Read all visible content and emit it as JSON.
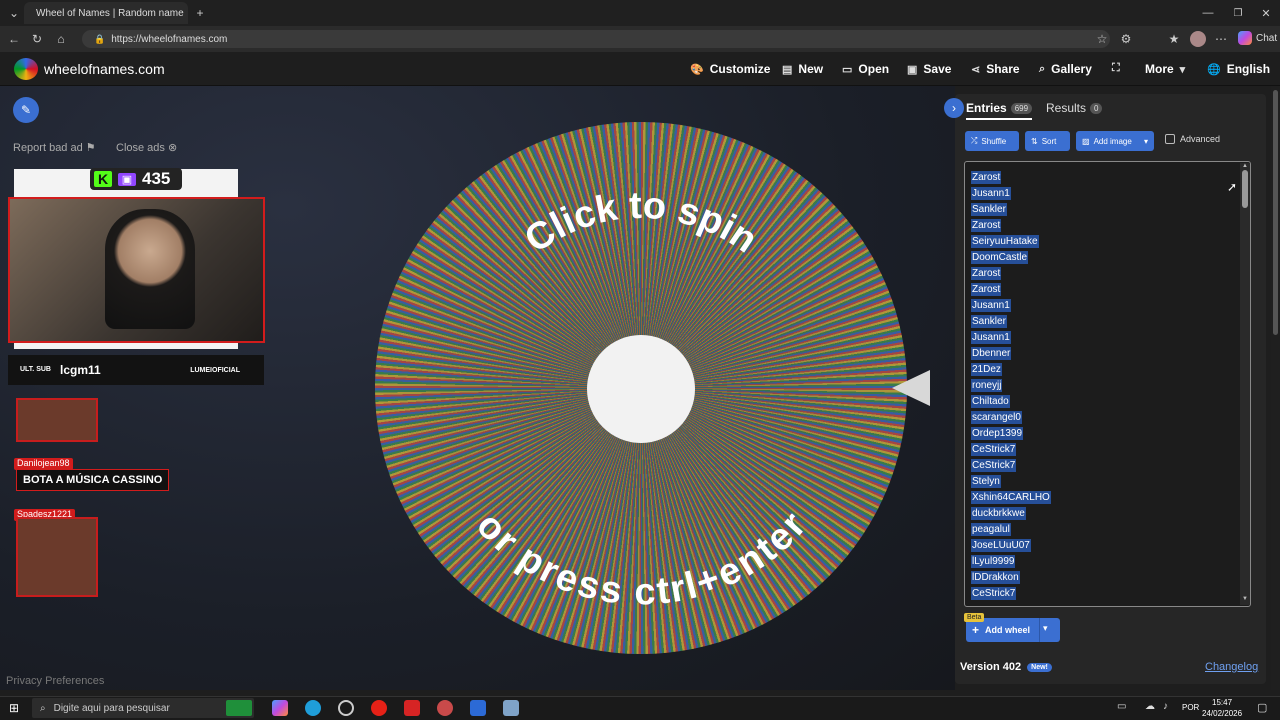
{
  "browser": {
    "tab_title": "Wheel of Names | Random name",
    "url": "https://wheelofnames.com",
    "chat_label": "Chat"
  },
  "header": {
    "site_name": "wheelofnames.com",
    "nav": {
      "customize": "Customize",
      "new": "New",
      "open": "Open",
      "save": "Save",
      "share": "Share",
      "gallery": "Gallery",
      "more": "More",
      "language": "English"
    }
  },
  "left": {
    "report_ad": "Report bad ad",
    "close_ads": "Close ads",
    "viewer_count": "435",
    "streamer_name": "lcgm11",
    "sub_label": "ULT. SUB",
    "channel_tag": "LUMEIOFICIAL",
    "chat": [
      {
        "user": "Danilojean98",
        "message": "BOTA A MÚSICA CASSINO"
      },
      {
        "user": "Spadesz1221",
        "message": ""
      }
    ],
    "privacy": "Privacy Preferences"
  },
  "wheel": {
    "top_text": "Click to spin",
    "bottom_text": "or press ctrl+enter"
  },
  "panel": {
    "tab_entries": "Entries",
    "entries_count": "699",
    "tab_results": "Results",
    "results_count": "0",
    "shuffle": "Shuffle",
    "sort": "Sort",
    "add_image": "Add image",
    "advanced": "Advanced",
    "entries": [
      "Zarost",
      "Jusann1",
      "Sankler",
      "Zarost",
      "SeiryuuHatake",
      "DoomCastle",
      "Zarost",
      "Zarost",
      "Jusann1",
      "Sankler",
      "Jusann1",
      "Dbenner",
      "21Dez",
      "roneyjj",
      "Chiltado",
      "scarangel0",
      "Ordep1399",
      "CeStrick7",
      "CeStrick7",
      "Stelyn",
      "Xshin64CARLHO",
      "duckbrkkwe",
      "peagalul",
      "JoseLUuU07",
      "lLyul9999",
      "lDDrakkon",
      "CeStrick7"
    ],
    "beta": "Beta",
    "add_wheel": "Add wheel",
    "version": "Version 402",
    "new_badge": "New!",
    "changelog": "Changelog"
  },
  "taskbar": {
    "search_placeholder": "Digite aqui para pesquisar",
    "lang": "POR",
    "time": "15:47",
    "date": "24/02/2026"
  }
}
